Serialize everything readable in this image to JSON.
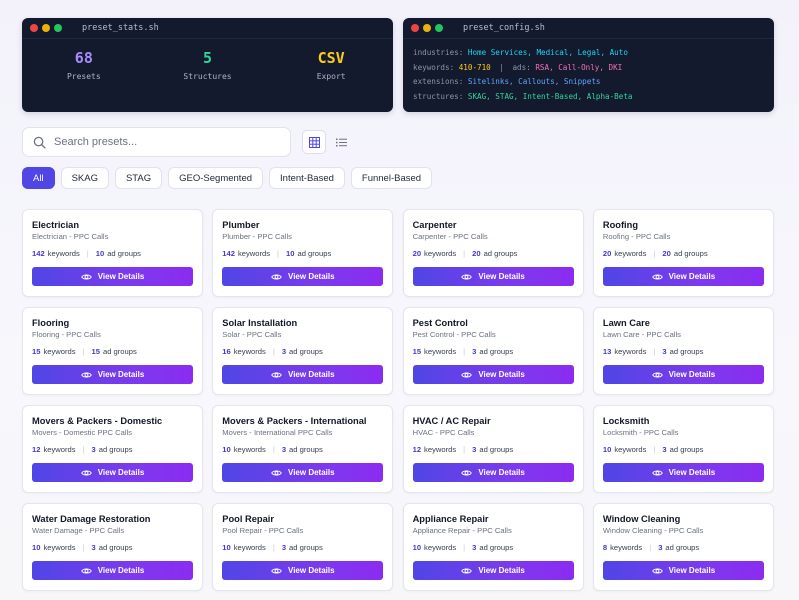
{
  "stats_terminal": {
    "title": "preset_stats.sh",
    "stats": [
      {
        "value": "68",
        "label": "Presets",
        "color": "#a78bfa"
      },
      {
        "value": "5",
        "label": "Structures",
        "color": "#34d399"
      },
      {
        "value": "CSV",
        "label": "Export",
        "color": "#facc15"
      }
    ]
  },
  "config_terminal": {
    "title": "preset_config.sh",
    "industries_key": "industries:",
    "industries_val": "Home Services, Medical, Legal, Auto",
    "keywords_key": "keywords:",
    "keywords_val": "410-710",
    "pipe": "|",
    "ads_key": "ads:",
    "ads_val": "RSA, Call-Only, DKI",
    "extensions_key": "extensions:",
    "extensions_val": "Sitelinks, Callouts, Snippets",
    "structures_key": "structures:",
    "structures_val": "SKAG, STAG, Intent-Based, Alpha-Beta"
  },
  "search": {
    "placeholder": "Search presets..."
  },
  "filters": [
    "All",
    "SKAG",
    "STAG",
    "GEO-Segmented",
    "Intent-Based",
    "Funnel-Based"
  ],
  "card_labels": {
    "keywords": "keywords",
    "ad_groups": "ad groups",
    "button": "View Details",
    "sep": "|"
  },
  "presets": [
    {
      "title": "Electrician",
      "subtitle": "Electrician - PPC Calls",
      "keywords": "142",
      "ad_groups": "10"
    },
    {
      "title": "Plumber",
      "subtitle": "Plumber - PPC Calls",
      "keywords": "142",
      "ad_groups": "10"
    },
    {
      "title": "Carpenter",
      "subtitle": "Carpenter - PPC Calls",
      "keywords": "20",
      "ad_groups": "20"
    },
    {
      "title": "Roofing",
      "subtitle": "Roofing - PPC Calls",
      "keywords": "20",
      "ad_groups": "20"
    },
    {
      "title": "Flooring",
      "subtitle": "Flooring - PPC Calls",
      "keywords": "15",
      "ad_groups": "15"
    },
    {
      "title": "Solar Installation",
      "subtitle": "Solar - PPC Calls",
      "keywords": "16",
      "ad_groups": "3"
    },
    {
      "title": "Pest Control",
      "subtitle": "Pest Control - PPC Calls",
      "keywords": "15",
      "ad_groups": "3"
    },
    {
      "title": "Lawn Care",
      "subtitle": "Lawn Care - PPC Calls",
      "keywords": "13",
      "ad_groups": "3"
    },
    {
      "title": "Movers & Packers - Domestic",
      "subtitle": "Movers - Domestic PPC Calls",
      "keywords": "12",
      "ad_groups": "3"
    },
    {
      "title": "Movers & Packers - International",
      "subtitle": "Movers - International PPC Calls",
      "keywords": "10",
      "ad_groups": "3"
    },
    {
      "title": "HVAC / AC Repair",
      "subtitle": "HVAC - PPC Calls",
      "keywords": "12",
      "ad_groups": "3"
    },
    {
      "title": "Locksmith",
      "subtitle": "Locksmith - PPC Calls",
      "keywords": "10",
      "ad_groups": "3"
    },
    {
      "title": "Water Damage Restoration",
      "subtitle": "Water Damage - PPC Calls",
      "keywords": "10",
      "ad_groups": "3"
    },
    {
      "title": "Pool Repair",
      "subtitle": "Pool Repair - PPC Calls",
      "keywords": "10",
      "ad_groups": "3"
    },
    {
      "title": "Appliance Repair",
      "subtitle": "Appliance Repair - PPC Calls",
      "keywords": "10",
      "ad_groups": "3"
    },
    {
      "title": "Window Cleaning",
      "subtitle": "Window Cleaning - PPC Calls",
      "keywords": "8",
      "ad_groups": "3"
    }
  ],
  "colors": {
    "accent": "#4f46e5",
    "accent_end": "#8b2cf0",
    "terminal_bg": "#131a2e"
  }
}
